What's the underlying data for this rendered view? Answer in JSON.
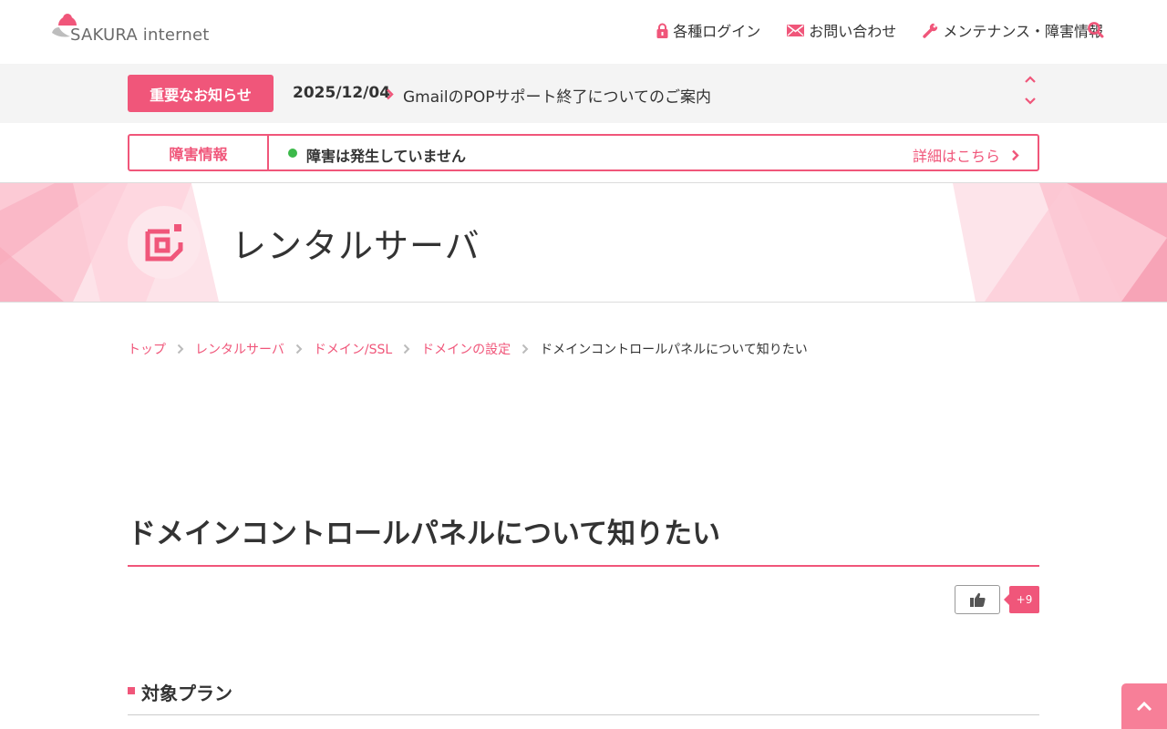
{
  "header": {
    "logo_text": "SAKURA internet",
    "nav": [
      {
        "label": "各種ログイン",
        "icon": "lock-icon"
      },
      {
        "label": "お問い合わせ",
        "icon": "mail-icon"
      },
      {
        "label": "メンテナンス・障害情報",
        "icon": "wrench-icon"
      }
    ],
    "search_icon": "search-icon"
  },
  "notice": {
    "badge": "重要なお知らせ",
    "date": "2025/12/04",
    "text": "GmailのPOPサポート終了についてのご案内"
  },
  "incident": {
    "label": "障害情報",
    "status": "障害は発生していません",
    "status_color": "#3cb94a",
    "link": "詳細はこちら"
  },
  "hero": {
    "title": "レンタルサーバ",
    "icon": "rental-server-icon"
  },
  "breadcrumb": {
    "items": [
      "トップ",
      "レンタルサーバ",
      "ドメイン/SSL",
      "ドメインの設定"
    ],
    "current": "ドメインコントロールパネルについて知りたい"
  },
  "article": {
    "title": "ドメインコントロールパネルについて知りたい",
    "like_count": "+9",
    "section_title": "対象プラン"
  },
  "colors": {
    "accent": "#f0567a",
    "pagetop": "#f77f98"
  }
}
